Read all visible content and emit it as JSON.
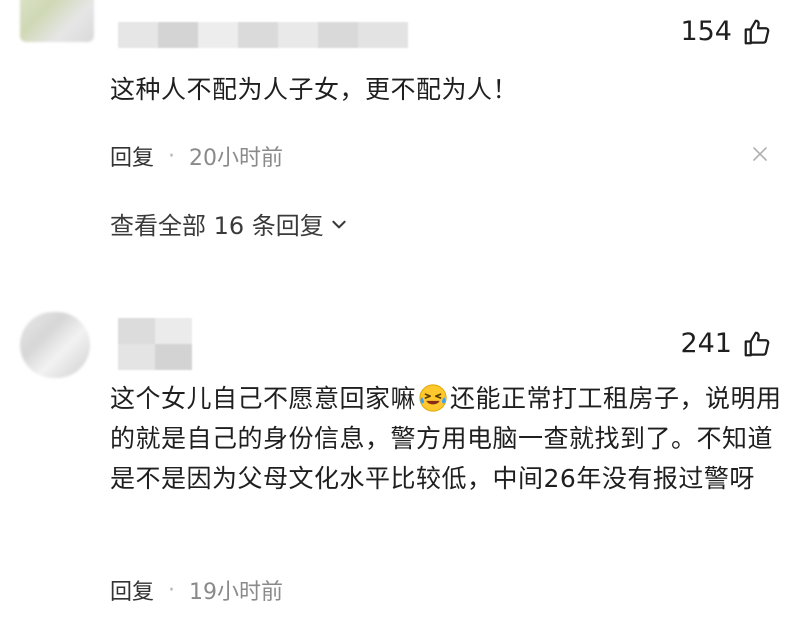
{
  "comments": [
    {
      "likes": "154",
      "text": "这种人不配为人子女，更不配为人！",
      "reply_label": "回复",
      "separator": "·",
      "time": "20小时前",
      "view_replies": "查看全部 16 条回复"
    },
    {
      "likes": "241",
      "text_before_emoji": "这个女儿自己不愿意回家嘛",
      "text_after_emoji": "还能正常打工租房子，说明用的就是自己的身份信息，警方用电脑一查就找到了。不知道是不是因为父母文化水平比较低，中间26年没有报过警呀",
      "emoji": "laughing-crying-emoji",
      "reply_label": "回复",
      "separator": "·",
      "time": "19小时前"
    }
  ],
  "icons": {
    "like": "thumbs-up-icon",
    "close": "close-icon",
    "expand": "chevron-down-icon"
  },
  "colors": {
    "text": "#1f1f1f",
    "meta": "#8a8a8a",
    "background": "#ffffff"
  }
}
